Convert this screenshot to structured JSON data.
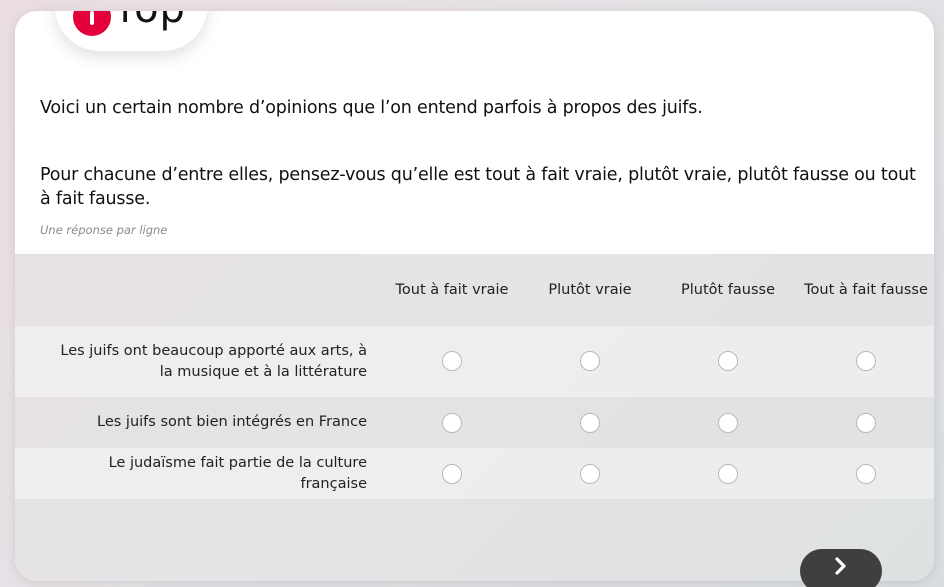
{
  "brand": {
    "logo_text": "fop",
    "accent_color": "#e4003a"
  },
  "question": {
    "intro": "Voici un certain nombre d’opinions que l’on entend parfois à propos des juifs.",
    "main": "Pour chacune d’entre elles, pensez-vous qu’elle est tout à fait vraie, plutôt vraie, plutôt fausse ou tout à fait fausse.",
    "hint": "Une réponse par ligne"
  },
  "grid": {
    "columns": [
      {
        "label": "Tout à fait vraie"
      },
      {
        "label": "Plutôt vraie"
      },
      {
        "label": "Plutôt fausse"
      },
      {
        "label": "Tout à fait fausse"
      }
    ],
    "rows": [
      {
        "label": "Les juifs ont beaucoup apporté aux arts, à la musique et à la littérature",
        "selected": null
      },
      {
        "label": "Les juifs sont bien intégrés en France",
        "selected": null
      },
      {
        "label": "Le judaïsme fait partie de la culture française",
        "selected": null
      }
    ]
  },
  "navigation": {
    "next_icon": "chevron-right-icon"
  }
}
